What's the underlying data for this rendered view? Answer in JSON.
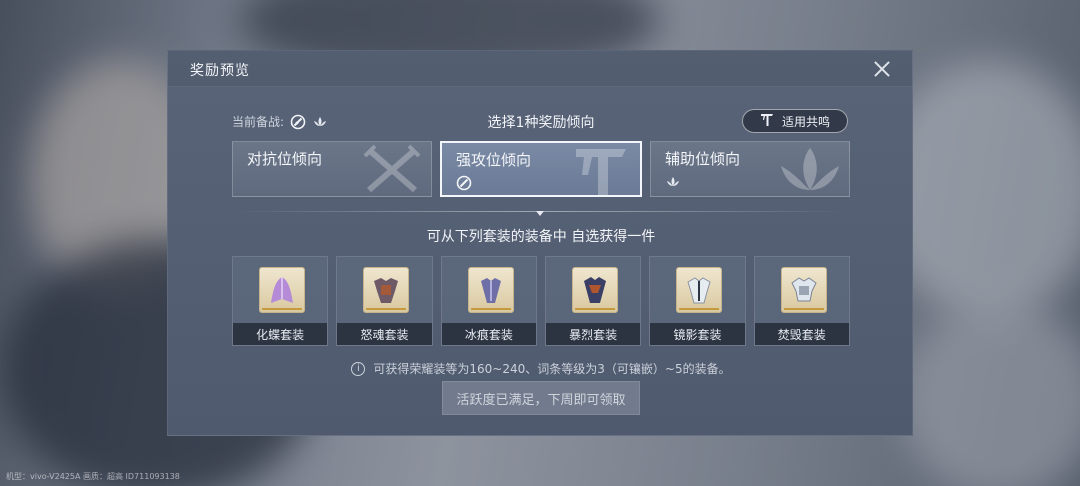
{
  "footer": {
    "device_text": "机型：vivo-V2425A 画质：超高 ID711093138"
  },
  "dialog": {
    "title": "奖励预览",
    "current_loadout_label": "当前备战:",
    "current_loadout_icons": [
      "attack-emblem-icon",
      "lotus-icon"
    ],
    "select_title": "选择1种奖励倾向",
    "resonance_button": {
      "icon": "resonance-icon",
      "label": "适用共鸣"
    },
    "tendencies": [
      {
        "label": "对抗位倾向",
        "icon": "",
        "watermark": "crossed-swords-icon",
        "selected": false
      },
      {
        "label": "强攻位倾向",
        "icon": "attack-emblem-icon",
        "watermark": "resonance-icon",
        "selected": true
      },
      {
        "label": "辅助位倾向",
        "icon": "lotus-icon",
        "watermark": "lotus-icon",
        "selected": false
      }
    ],
    "sub_title": "可从下列套装的装备中 自选获得一件",
    "sets": [
      {
        "label": "化蝶套装",
        "icon": "butterfly-cloak-icon",
        "color": "#b58ad6"
      },
      {
        "label": "怒魂套装",
        "icon": "rage-armor-icon",
        "color": "#6e5a67"
      },
      {
        "label": "冰痕套装",
        "icon": "ice-armor-icon",
        "color": "#6f6fa8"
      },
      {
        "label": "暴烈套装",
        "icon": "fury-armor-icon",
        "color": "#3a3f66"
      },
      {
        "label": "镜影套装",
        "icon": "mirror-armor-icon",
        "color": "#e7ecf1"
      },
      {
        "label": "焚毁套装",
        "icon": "blaze-armor-icon",
        "color": "#dfe6ee"
      }
    ],
    "info_text": "可获得荣耀装等为160~240、词条等级为3（可镶嵌）~5的装备。",
    "claim_button": "活跃度已满足，下周即可领取"
  },
  "colors": {
    "panel": "#596478",
    "selected_border": "#f3f6fb",
    "item_frame": "#efe6cf"
  }
}
